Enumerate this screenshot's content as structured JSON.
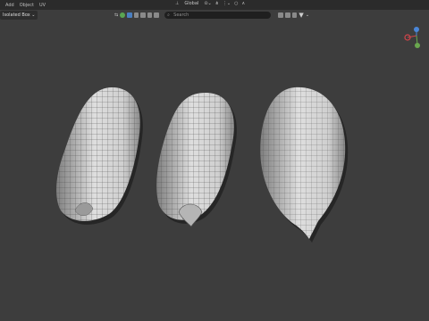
{
  "menu": [
    "Add",
    "Object",
    "UV"
  ],
  "header": {
    "orientation": "Global",
    "pivot_icon": "pivot-icon",
    "snap_icon": "magnet-icon",
    "proportional_icon": "proportional-icon"
  },
  "toolbar": {
    "mode_label": "Isolated Box ⌄",
    "search_placeholder": "Search"
  },
  "gizmo": {
    "x_color": "#d1454a",
    "y_color": "#6aa84f",
    "z_color": "#4a86d8"
  }
}
